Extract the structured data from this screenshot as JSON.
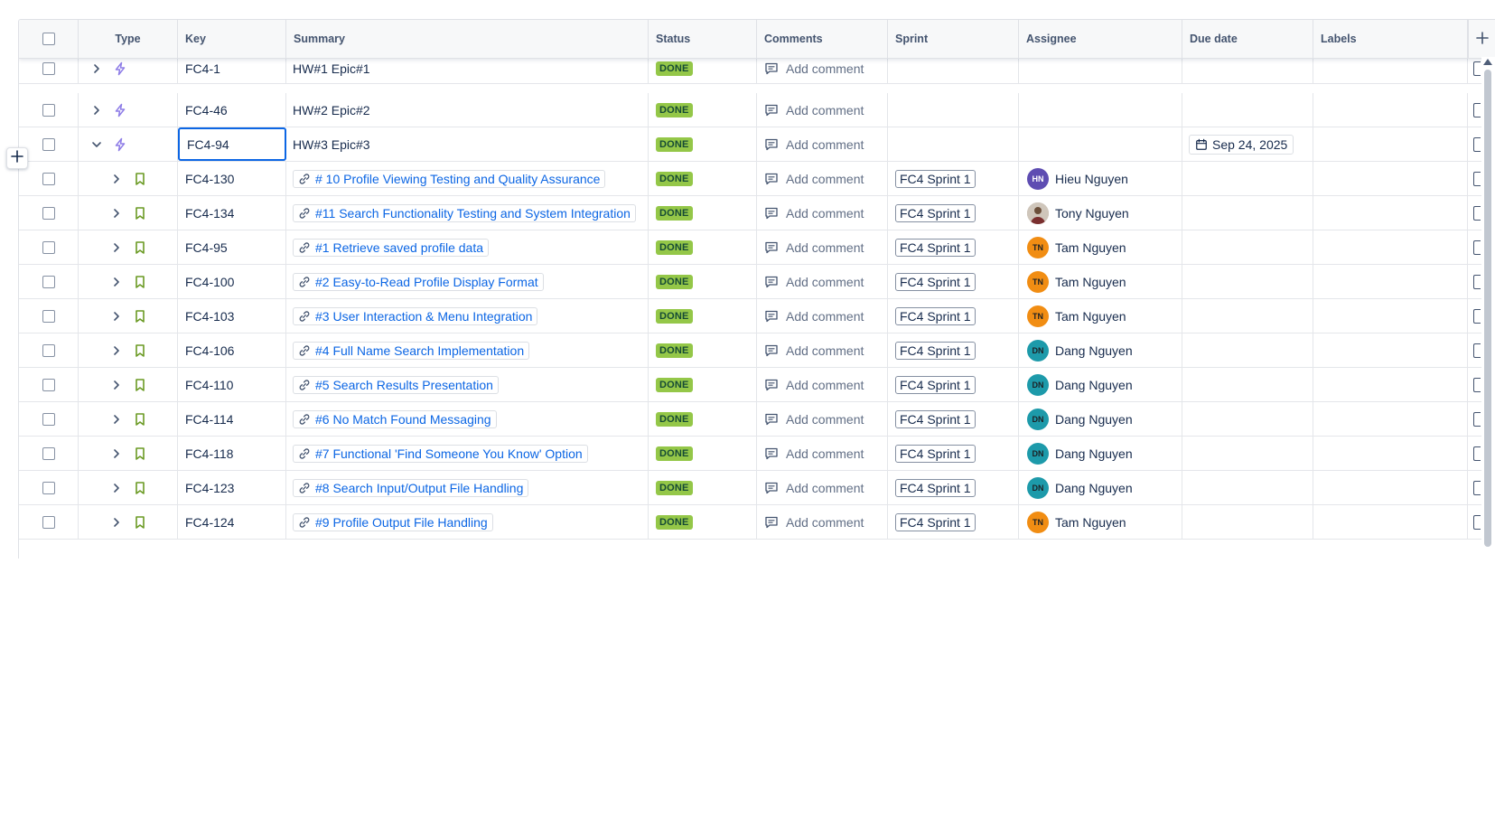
{
  "table": {
    "columns": {
      "type": "Type",
      "key": "Key",
      "summary": "Summary",
      "status": "Status",
      "comments": "Comments",
      "sprint": "Sprint",
      "assignee": "Assignee",
      "due": "Due date",
      "labels": "Labels"
    },
    "rows": [
      {
        "key": "FC4-1",
        "summary": "HW#1 Epic#1",
        "status": "DONE",
        "comment": "Add comment",
        "sprint": "",
        "assignee": "",
        "avatar": "",
        "due": "",
        "level": 0,
        "expanded": false,
        "type": "epic",
        "linked": false,
        "selected": false
      },
      {
        "key": "FC4-46",
        "summary": "HW#2 Epic#2",
        "status": "DONE",
        "comment": "Add comment",
        "sprint": "",
        "assignee": "",
        "avatar": "",
        "due": "",
        "level": 0,
        "expanded": false,
        "type": "epic",
        "linked": false,
        "selected": false
      },
      {
        "key": "FC4-94",
        "summary": "HW#3 Epic#3",
        "status": "DONE",
        "comment": "Add comment",
        "sprint": "",
        "assignee": "",
        "avatar": "",
        "due": "Sep 24, 2025",
        "level": 0,
        "expanded": true,
        "type": "epic",
        "linked": false,
        "selected": true
      },
      {
        "key": "FC4-130",
        "summary": "# 10 Profile Viewing Testing and Quality Assurance",
        "status": "DONE",
        "comment": "Add comment",
        "sprint": "FC4 Sprint 1",
        "assignee": "Hieu Nguyen",
        "avatar": "HN",
        "due": "",
        "level": 1,
        "expanded": false,
        "type": "story",
        "linked": true,
        "selected": false
      },
      {
        "key": "FC4-134",
        "summary": "#11 Search Functionality Testing and System Integration",
        "status": "DONE",
        "comment": "Add comment",
        "sprint": "FC4 Sprint 1",
        "assignee": "Tony Nguyen",
        "avatar": "",
        "due": "",
        "level": 1,
        "expanded": false,
        "type": "story",
        "linked": true,
        "selected": false
      },
      {
        "key": "FC4-95",
        "summary": "#1 Retrieve saved profile data",
        "status": "DONE",
        "comment": "Add comment",
        "sprint": "FC4 Sprint 1",
        "assignee": "Tam Nguyen",
        "avatar": "TN",
        "due": "",
        "level": 1,
        "expanded": false,
        "type": "story",
        "linked": true,
        "selected": false
      },
      {
        "key": "FC4-100",
        "summary": "#2 Easy-to-Read Profile Display Format",
        "status": "DONE",
        "comment": "Add comment",
        "sprint": "FC4 Sprint 1",
        "assignee": "Tam Nguyen",
        "avatar": "TN",
        "due": "",
        "level": 1,
        "expanded": false,
        "type": "story",
        "linked": true,
        "selected": false
      },
      {
        "key": "FC4-103",
        "summary": "#3 User Interaction & Menu Integration",
        "status": "DONE",
        "comment": "Add comment",
        "sprint": "FC4 Sprint 1",
        "assignee": "Tam Nguyen",
        "avatar": "TN",
        "due": "",
        "level": 1,
        "expanded": false,
        "type": "story",
        "linked": true,
        "selected": false
      },
      {
        "key": "FC4-106",
        "summary": "#4 Full Name Search Implementation",
        "status": "DONE",
        "comment": "Add comment",
        "sprint": "FC4 Sprint 1",
        "assignee": "Dang Nguyen",
        "avatar": "DN",
        "due": "",
        "level": 1,
        "expanded": false,
        "type": "story",
        "linked": true,
        "selected": false
      },
      {
        "key": "FC4-110",
        "summary": "#5 Search Results Presentation",
        "status": "DONE",
        "comment": "Add comment",
        "sprint": "FC4 Sprint 1",
        "assignee": "Dang Nguyen",
        "avatar": "DN",
        "due": "",
        "level": 1,
        "expanded": false,
        "type": "story",
        "linked": true,
        "selected": false
      },
      {
        "key": "FC4-114",
        "summary": "#6 No Match Found Messaging",
        "status": "DONE",
        "comment": "Add comment",
        "sprint": "FC4 Sprint 1",
        "assignee": "Dang Nguyen",
        "avatar": "DN",
        "due": "",
        "level": 1,
        "expanded": false,
        "type": "story",
        "linked": true,
        "selected": false
      },
      {
        "key": "FC4-118",
        "summary": "#7 Functional 'Find Someone You Know' Option",
        "status": "DONE",
        "comment": "Add comment",
        "sprint": "FC4 Sprint 1",
        "assignee": "Dang Nguyen",
        "avatar": "DN",
        "due": "",
        "level": 1,
        "expanded": false,
        "type": "story",
        "linked": true,
        "selected": false
      },
      {
        "key": "FC4-123",
        "summary": "#8 Search Input/Output File Handling",
        "status": "DONE",
        "comment": "Add comment",
        "sprint": "FC4 Sprint 1",
        "assignee": "Dang Nguyen",
        "avatar": "DN",
        "due": "",
        "level": 1,
        "expanded": false,
        "type": "story",
        "linked": true,
        "selected": false
      },
      {
        "key": "FC4-124",
        "summary": "#9 Profile Output File Handling",
        "status": "DONE",
        "comment": "Add comment",
        "sprint": "FC4 Sprint 1",
        "assignee": "Tam Nguyen",
        "avatar": "TN",
        "due": "",
        "level": 1,
        "expanded": false,
        "type": "story",
        "linked": true,
        "selected": false
      }
    ]
  },
  "colors": {
    "status_done_bg": "#94c748",
    "link": "#0c66e4",
    "epic_icon": "#8f7ee7",
    "story_icon": "#6a9a23",
    "selection_border": "#0c66e4"
  },
  "icons": {
    "epic": "lightning-icon",
    "story": "bookmark-icon",
    "comment": "comment-icon",
    "link": "link-icon",
    "calendar": "calendar-icon",
    "add": "plus-icon"
  }
}
